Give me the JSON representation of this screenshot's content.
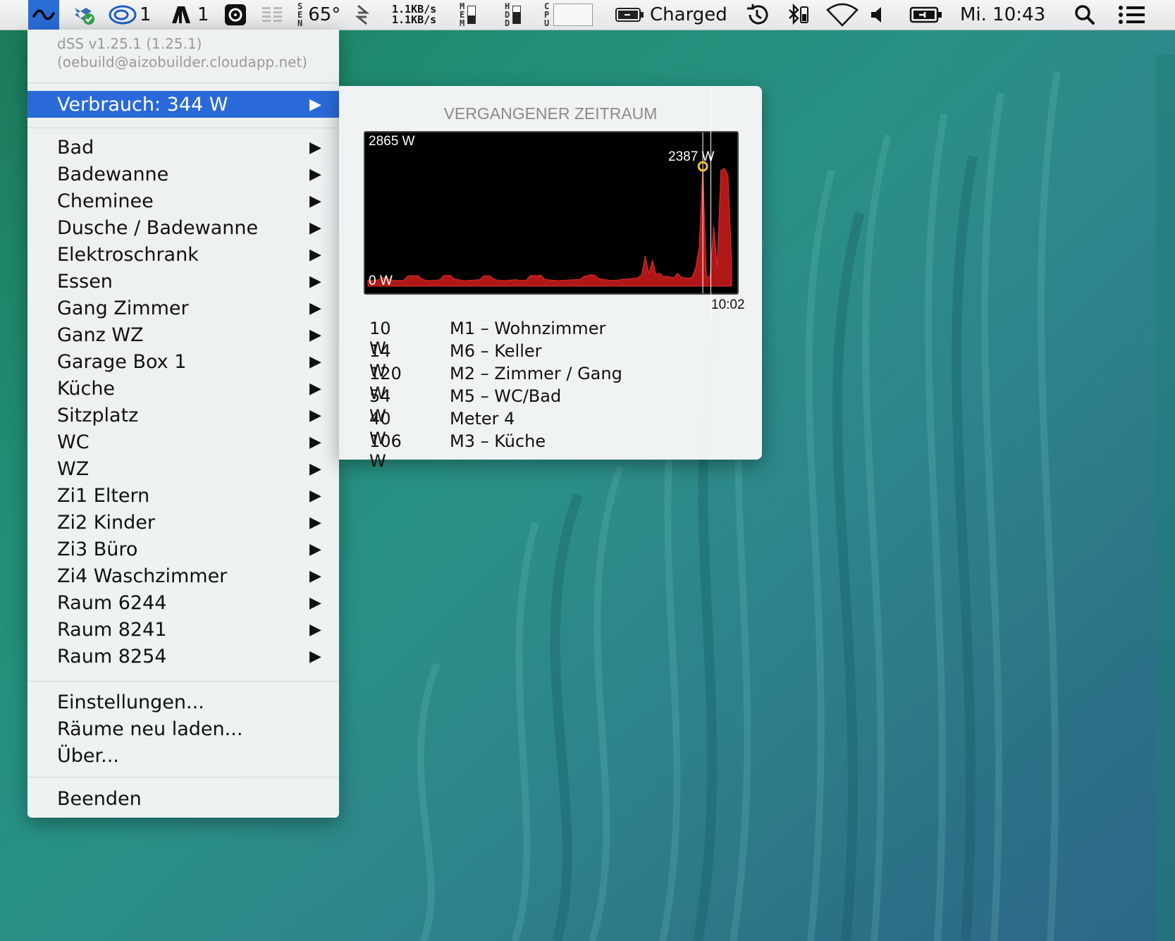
{
  "menubar": {
    "app_icon": "wave-icon",
    "icons": [
      {
        "name": "dropbox-sync-icon"
      },
      {
        "name": "creative-cloud-icon",
        "count": "1"
      },
      {
        "name": "adobe-icon",
        "count": "1"
      },
      {
        "name": "istat-icon"
      }
    ],
    "sensor_label": "SEN",
    "temperature": "65°",
    "net_up": "1.1KB/s",
    "net_down": "1.1KB/s",
    "mem_label": "MEM",
    "hdd_label": "HDD",
    "cpu_label": "CPU",
    "mem_level": 0.45,
    "hdd_level": 0.65,
    "battery_status": "Charged",
    "clock": "Mi. 10:43"
  },
  "menu": {
    "version": "dSS v1.25.1 (1.25.1)",
    "build": "(oebuild@aizobuilder.cloudapp.net)",
    "consumption": "Verbrauch: 344 W",
    "rooms": [
      "Bad",
      "Badewanne",
      "Cheminee",
      "Dusche / Badewanne",
      "Elektroschrank",
      "Essen",
      "Gang Zimmer",
      "Ganz WZ",
      "Garage Box 1",
      "Küche",
      "Sitzplatz",
      "WC",
      "WZ",
      "Zi1 Eltern",
      "Zi2 Kinder",
      "Zi3 Büro",
      "Zi4 Waschzimmer",
      "Raum 6244",
      "Raum 8241",
      "Raum 8254"
    ],
    "settings": "Einstellungen...",
    "reload": "Räume neu laden...",
    "about": "Über...",
    "quit": "Beenden",
    "arrow_glyph": "▶"
  },
  "popover": {
    "title": "VERGANGENER ZEITRAUM",
    "max_label": "2865 W",
    "min_label": "0 W",
    "cursor_value": "2387 W",
    "cursor_time": "10:02",
    "meters": [
      {
        "watts": "10 W",
        "name": "M1 – Wohnzimmer"
      },
      {
        "watts": "14 W",
        "name": "M6 – Keller"
      },
      {
        "watts": "120 W",
        "name": "M2 – Zimmer / Gang"
      },
      {
        "watts": "54 W",
        "name": "M5 – WC/Bad"
      },
      {
        "watts": "40 W",
        "name": "Meter 4"
      },
      {
        "watts": "106 W",
        "name": "M3 – Küche"
      }
    ]
  },
  "chart_data": {
    "type": "area",
    "ylim": [
      0,
      2865
    ],
    "color": "#b01818",
    "cursor_index": 93,
    "values": [
      120,
      110,
      120,
      130,
      160,
      180,
      130,
      120,
      110,
      115,
      120,
      200,
      210,
      205,
      210,
      140,
      120,
      110,
      115,
      120,
      130,
      210,
      215,
      210,
      140,
      130,
      120,
      110,
      115,
      120,
      125,
      130,
      200,
      210,
      200,
      140,
      120,
      115,
      110,
      120,
      125,
      130,
      120,
      115,
      120,
      210,
      215,
      210,
      220,
      140,
      130,
      120,
      115,
      110,
      115,
      120,
      125,
      130,
      130,
      140,
      200,
      210,
      230,
      220,
      150,
      140,
      130,
      120,
      115,
      120,
      130,
      140,
      145,
      150,
      160,
      170,
      230,
      600,
      250,
      520,
      230,
      260,
      190,
      200,
      180,
      170,
      260,
      180,
      170,
      160,
      175,
      360,
      780,
      2387,
      200,
      180,
      1200,
      400,
      2300,
      2350,
      2200,
      450
    ]
  }
}
